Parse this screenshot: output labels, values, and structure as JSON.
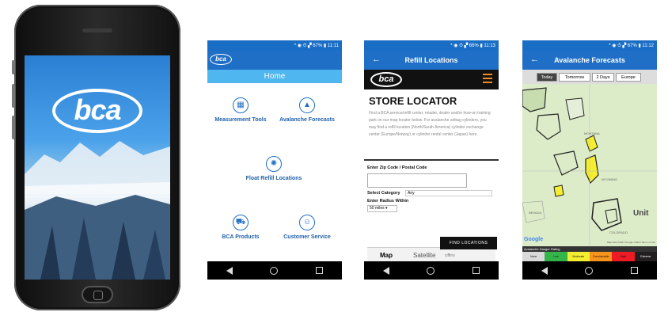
{
  "splash": {
    "logo": "bca"
  },
  "home_phone": {
    "status": "* ◉ ⏱ ▞ 67% ▮ 11:11",
    "logo": "bca",
    "title": "Home",
    "tiles": [
      {
        "label": "Measurement Tools",
        "icon": "measurement-icon"
      },
      {
        "label": "Avalanche Forecasts",
        "icon": "mountain-icon"
      },
      {
        "label": "Float Refill Locations",
        "icon": "float-icon"
      },
      {
        "label": "BCA Products",
        "icon": "cart-icon"
      },
      {
        "label": "Customer Service",
        "icon": "service-icon"
      }
    ]
  },
  "refill_phone": {
    "status": "* ◉ ⏱ ▞ 66% ▮ 11:13",
    "back": "←",
    "title": "Refill Locations",
    "logo": "bca",
    "store_title": "STORE LOCATOR",
    "description": "Find a BCA service/refill center, retailer, dealer and/or how-on training park on our map locator below. For avalanche airbag cylinders, you may find a refill location (North/South America) cylinder exchange center (Europe/Norway) or cylinder rental center (Japan) here.",
    "zip_label": "Enter Zip Code / Postal Code",
    "category_label": "Select Category",
    "category_value": "Any",
    "radius_label": "Enter Radius Within",
    "radius_value": "50 miles",
    "find_button": "FIND LOCATIONS",
    "map_tab": "Map",
    "satellite_tab": "Satellite",
    "map_snippet": "ciffins"
  },
  "forecast_phone": {
    "status": "* ◉ ⏱ ▞ 67% ▮ 11:12",
    "back": "←",
    "title": "Avalanche Forecasts",
    "tabs": [
      "Today",
      "Tomorrow",
      "2 Days",
      "Europe"
    ],
    "map_labels": [
      "MONTANA",
      "WYOMING",
      "NEVADA",
      "COLORADO",
      "Unit"
    ],
    "google": "Google",
    "attribution": "Map data ©2017 Google, INEGI  Terms of Use",
    "legend_title": "Avalanche Danger Rating",
    "legend": [
      {
        "label": "None",
        "color": "#d9d9d9"
      },
      {
        "label": "Low",
        "color": "#33b54a"
      },
      {
        "label": "Moderate",
        "color": "#f5ee30"
      },
      {
        "label": "Considerable",
        "color": "#f7941d"
      },
      {
        "label": "High",
        "color": "#ed1c24"
      },
      {
        "label": "Extreme",
        "color": "#231f20"
      }
    ]
  }
}
